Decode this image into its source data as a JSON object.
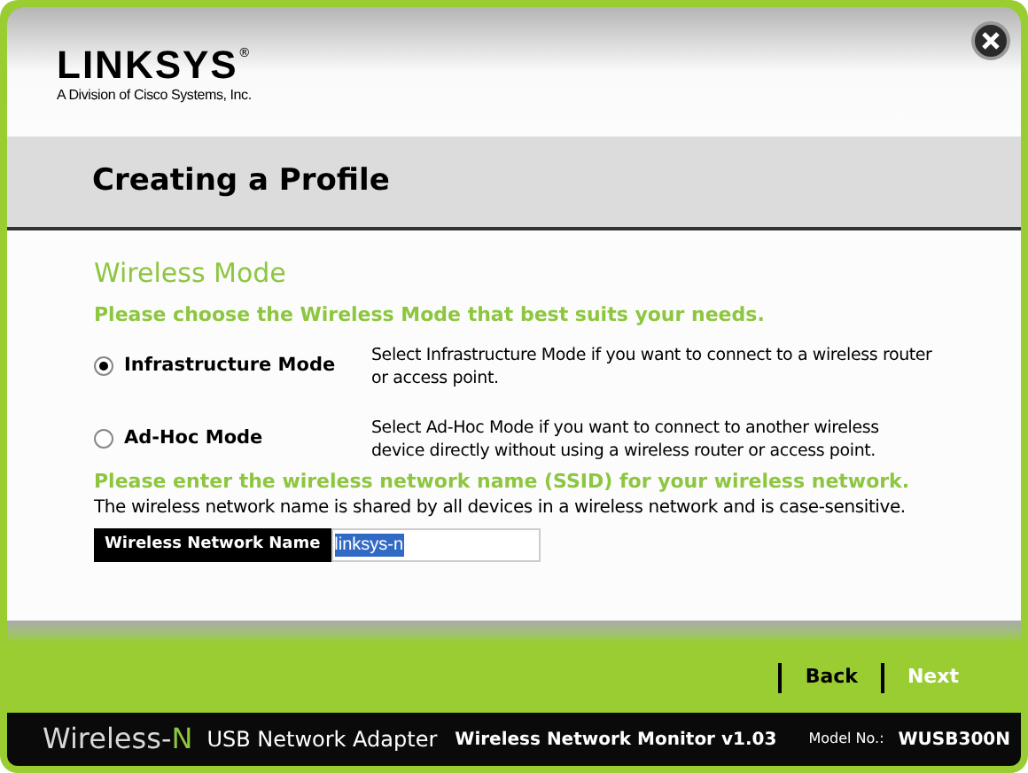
{
  "header": {
    "logo": "LINKSYS",
    "registered": "®",
    "tagline": "A Division of Cisco Systems, Inc."
  },
  "title": "Creating a Profile",
  "section": {
    "heading": "Wireless Mode",
    "prompt": "Please choose the Wireless Mode that best suits your needs.",
    "modes": [
      {
        "label": "Infrastructure Mode",
        "description": "Select Infrastructure Mode if you want to connect to a wireless router or access point.",
        "selected": true
      },
      {
        "label": "Ad-Hoc Mode",
        "description": "Select Ad-Hoc Mode if you want to connect to another wireless device directly without using a wireless router or access point.",
        "selected": false
      }
    ],
    "ssid_prompt": "Please enter the wireless network name (SSID) for your wireless network.",
    "ssid_note": "The wireless network name is shared by all devices in a wireless network and is case-sensitive.",
    "ssid_label": "Wireless Network Name",
    "ssid_value": "linksys-n"
  },
  "buttons": [
    {
      "label": "Back",
      "kind": "secondary"
    },
    {
      "label": "Next",
      "kind": "primary"
    }
  ],
  "footer": {
    "brand_prefix": "Wireless-",
    "brand_suffix": "N",
    "product": "USB Network Adapter",
    "app": "Wireless Network Monitor v1.03",
    "model_label": "Model No.:",
    "model": "WUSB300N"
  }
}
